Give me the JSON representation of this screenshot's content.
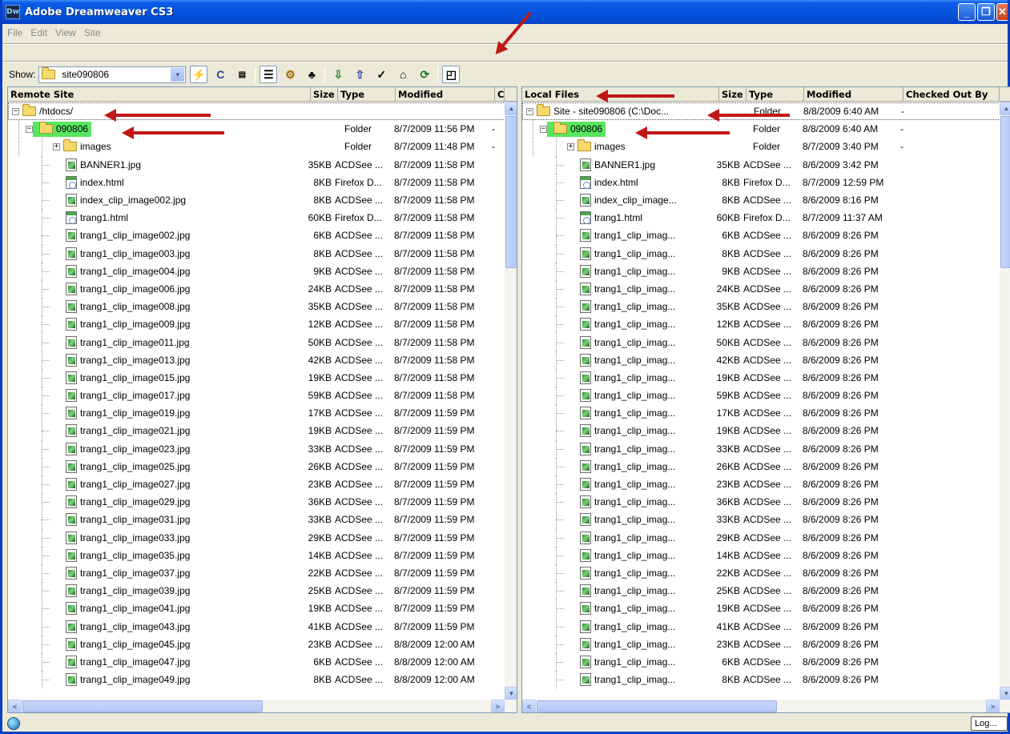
{
  "window": {
    "title": "Adobe Dreamweaver CS3",
    "logo_text": "Dw"
  },
  "menu": [
    "File",
    "Edit",
    "View",
    "Site"
  ],
  "toolbar": {
    "show_label": "Show:",
    "site_value": "site090806"
  },
  "remote": {
    "headers": [
      "Remote Site",
      "Size",
      "Type",
      "Modified",
      "C"
    ],
    "root": "/htdocs/",
    "folder": {
      "name": "090806",
      "type": "Folder",
      "modified": "8/7/2009 11:56 PM",
      "checked": "-"
    },
    "images": {
      "name": "images",
      "type": "Folder",
      "modified": "8/7/2009 11:48 PM",
      "checked": "-"
    },
    "files": [
      {
        "name": "BANNER1.jpg",
        "size": "35KB",
        "type": "ACDSee ...",
        "modified": "8/7/2009 11:58 PM",
        "icon": "image"
      },
      {
        "name": "index.html",
        "size": "8KB",
        "type": "Firefox D...",
        "modified": "8/7/2009 11:58 PM",
        "icon": "html"
      },
      {
        "name": "index_clip_image002.jpg",
        "size": "8KB",
        "type": "ACDSee ...",
        "modified": "8/7/2009 11:58 PM",
        "icon": "image"
      },
      {
        "name": "trang1.html",
        "size": "60KB",
        "type": "Firefox D...",
        "modified": "8/7/2009 11:58 PM",
        "icon": "html"
      },
      {
        "name": "trang1_clip_image002.jpg",
        "size": "6KB",
        "type": "ACDSee ...",
        "modified": "8/7/2009 11:58 PM",
        "icon": "image"
      },
      {
        "name": "trang1_clip_image003.jpg",
        "size": "8KB",
        "type": "ACDSee ...",
        "modified": "8/7/2009 11:58 PM",
        "icon": "image"
      },
      {
        "name": "trang1_clip_image004.jpg",
        "size": "9KB",
        "type": "ACDSee ...",
        "modified": "8/7/2009 11:58 PM",
        "icon": "image"
      },
      {
        "name": "trang1_clip_image006.jpg",
        "size": "24KB",
        "type": "ACDSee ...",
        "modified": "8/7/2009 11:58 PM",
        "icon": "image"
      },
      {
        "name": "trang1_clip_image008.jpg",
        "size": "35KB",
        "type": "ACDSee ...",
        "modified": "8/7/2009 11:58 PM",
        "icon": "image"
      },
      {
        "name": "trang1_clip_image009.jpg",
        "size": "12KB",
        "type": "ACDSee ...",
        "modified": "8/7/2009 11:58 PM",
        "icon": "image"
      },
      {
        "name": "trang1_clip_image011.jpg",
        "size": "50KB",
        "type": "ACDSee ...",
        "modified": "8/7/2009 11:58 PM",
        "icon": "image"
      },
      {
        "name": "trang1_clip_image013.jpg",
        "size": "42KB",
        "type": "ACDSee ...",
        "modified": "8/7/2009 11:58 PM",
        "icon": "image"
      },
      {
        "name": "trang1_clip_image015.jpg",
        "size": "19KB",
        "type": "ACDSee ...",
        "modified": "8/7/2009 11:58 PM",
        "icon": "image"
      },
      {
        "name": "trang1_clip_image017.jpg",
        "size": "59KB",
        "type": "ACDSee ...",
        "modified": "8/7/2009 11:58 PM",
        "icon": "image"
      },
      {
        "name": "trang1_clip_image019.jpg",
        "size": "17KB",
        "type": "ACDSee ...",
        "modified": "8/7/2009 11:59 PM",
        "icon": "image"
      },
      {
        "name": "trang1_clip_image021.jpg",
        "size": "19KB",
        "type": "ACDSee ...",
        "modified": "8/7/2009 11:59 PM",
        "icon": "image"
      },
      {
        "name": "trang1_clip_image023.jpg",
        "size": "33KB",
        "type": "ACDSee ...",
        "modified": "8/7/2009 11:59 PM",
        "icon": "image"
      },
      {
        "name": "trang1_clip_image025.jpg",
        "size": "26KB",
        "type": "ACDSee ...",
        "modified": "8/7/2009 11:59 PM",
        "icon": "image"
      },
      {
        "name": "trang1_clip_image027.jpg",
        "size": "23KB",
        "type": "ACDSee ...",
        "modified": "8/7/2009 11:59 PM",
        "icon": "image"
      },
      {
        "name": "trang1_clip_image029.jpg",
        "size": "36KB",
        "type": "ACDSee ...",
        "modified": "8/7/2009 11:59 PM",
        "icon": "image"
      },
      {
        "name": "trang1_clip_image031.jpg",
        "size": "33KB",
        "type": "ACDSee ...",
        "modified": "8/7/2009 11:59 PM",
        "icon": "image"
      },
      {
        "name": "trang1_clip_image033.jpg",
        "size": "29KB",
        "type": "ACDSee ...",
        "modified": "8/7/2009 11:59 PM",
        "icon": "image"
      },
      {
        "name": "trang1_clip_image035.jpg",
        "size": "14KB",
        "type": "ACDSee ...",
        "modified": "8/7/2009 11:59 PM",
        "icon": "image"
      },
      {
        "name": "trang1_clip_image037.jpg",
        "size": "22KB",
        "type": "ACDSee ...",
        "modified": "8/7/2009 11:59 PM",
        "icon": "image"
      },
      {
        "name": "trang1_clip_image039.jpg",
        "size": "25KB",
        "type": "ACDSee ...",
        "modified": "8/7/2009 11:59 PM",
        "icon": "image"
      },
      {
        "name": "trang1_clip_image041.jpg",
        "size": "19KB",
        "type": "ACDSee ...",
        "modified": "8/7/2009 11:59 PM",
        "icon": "image"
      },
      {
        "name": "trang1_clip_image043.jpg",
        "size": "41KB",
        "type": "ACDSee ...",
        "modified": "8/7/2009 11:59 PM",
        "icon": "image"
      },
      {
        "name": "trang1_clip_image045.jpg",
        "size": "23KB",
        "type": "ACDSee ...",
        "modified": "8/8/2009 12:00 AM",
        "icon": "image"
      },
      {
        "name": "trang1_clip_image047.jpg",
        "size": "6KB",
        "type": "ACDSee ...",
        "modified": "8/8/2009 12:00 AM",
        "icon": "image"
      },
      {
        "name": "trang1_clip_image049.jpg",
        "size": "8KB",
        "type": "ACDSee ...",
        "modified": "8/8/2009 12:00 AM",
        "icon": "image"
      }
    ]
  },
  "local": {
    "headers": [
      "Local Files",
      "Size",
      "Type",
      "Modified",
      "Checked Out By"
    ],
    "root": {
      "name": "Site - site090806 (C:\\Doc...",
      "type": "Folder",
      "modified": "8/8/2009 6:40 AM",
      "checked": "-"
    },
    "folder": {
      "name": "090806",
      "type": "Folder",
      "modified": "8/8/2009 6:40 AM",
      "checked": "-"
    },
    "images": {
      "name": "images",
      "type": "Folder",
      "modified": "8/7/2009 3:40 PM",
      "checked": "-"
    },
    "files": [
      {
        "name": "BANNER1.jpg",
        "size": "35KB",
        "type": "ACDSee ...",
        "modified": "8/6/2009 3:42 PM",
        "icon": "image"
      },
      {
        "name": "index.html",
        "size": "8KB",
        "type": "Firefox D...",
        "modified": "8/7/2009 12:59 PM",
        "icon": "html"
      },
      {
        "name": "index_clip_image...",
        "size": "8KB",
        "type": "ACDSee ...",
        "modified": "8/6/2009 8:16 PM",
        "icon": "image"
      },
      {
        "name": "trang1.html",
        "size": "60KB",
        "type": "Firefox D...",
        "modified": "8/7/2009 11:37 AM",
        "icon": "html"
      },
      {
        "name": "trang1_clip_imag...",
        "size": "6KB",
        "type": "ACDSee ...",
        "modified": "8/6/2009 8:26 PM",
        "icon": "image"
      },
      {
        "name": "trang1_clip_imag...",
        "size": "8KB",
        "type": "ACDSee ...",
        "modified": "8/6/2009 8:26 PM",
        "icon": "image"
      },
      {
        "name": "trang1_clip_imag...",
        "size": "9KB",
        "type": "ACDSee ...",
        "modified": "8/6/2009 8:26 PM",
        "icon": "image"
      },
      {
        "name": "trang1_clip_imag...",
        "size": "24KB",
        "type": "ACDSee ...",
        "modified": "8/6/2009 8:26 PM",
        "icon": "image"
      },
      {
        "name": "trang1_clip_imag...",
        "size": "35KB",
        "type": "ACDSee ...",
        "modified": "8/6/2009 8:26 PM",
        "icon": "image"
      },
      {
        "name": "trang1_clip_imag...",
        "size": "12KB",
        "type": "ACDSee ...",
        "modified": "8/6/2009 8:26 PM",
        "icon": "image"
      },
      {
        "name": "trang1_clip_imag...",
        "size": "50KB",
        "type": "ACDSee ...",
        "modified": "8/6/2009 8:26 PM",
        "icon": "image"
      },
      {
        "name": "trang1_clip_imag...",
        "size": "42KB",
        "type": "ACDSee ...",
        "modified": "8/6/2009 8:26 PM",
        "icon": "image"
      },
      {
        "name": "trang1_clip_imag...",
        "size": "19KB",
        "type": "ACDSee ...",
        "modified": "8/6/2009 8:26 PM",
        "icon": "image"
      },
      {
        "name": "trang1_clip_imag...",
        "size": "59KB",
        "type": "ACDSee ...",
        "modified": "8/6/2009 8:26 PM",
        "icon": "image"
      },
      {
        "name": "trang1_clip_imag...",
        "size": "17KB",
        "type": "ACDSee ...",
        "modified": "8/6/2009 8:26 PM",
        "icon": "image"
      },
      {
        "name": "trang1_clip_imag...",
        "size": "19KB",
        "type": "ACDSee ...",
        "modified": "8/6/2009 8:26 PM",
        "icon": "image"
      },
      {
        "name": "trang1_clip_imag...",
        "size": "33KB",
        "type": "ACDSee ...",
        "modified": "8/6/2009 8:26 PM",
        "icon": "image"
      },
      {
        "name": "trang1_clip_imag...",
        "size": "26KB",
        "type": "ACDSee ...",
        "modified": "8/6/2009 8:26 PM",
        "icon": "image"
      },
      {
        "name": "trang1_clip_imag...",
        "size": "23KB",
        "type": "ACDSee ...",
        "modified": "8/6/2009 8:26 PM",
        "icon": "image"
      },
      {
        "name": "trang1_clip_imag...",
        "size": "36KB",
        "type": "ACDSee ...",
        "modified": "8/6/2009 8:26 PM",
        "icon": "image"
      },
      {
        "name": "trang1_clip_imag...",
        "size": "33KB",
        "type": "ACDSee ...",
        "modified": "8/6/2009 8:26 PM",
        "icon": "image"
      },
      {
        "name": "trang1_clip_imag...",
        "size": "29KB",
        "type": "ACDSee ...",
        "modified": "8/6/2009 8:26 PM",
        "icon": "image"
      },
      {
        "name": "trang1_clip_imag...",
        "size": "14KB",
        "type": "ACDSee ...",
        "modified": "8/6/2009 8:26 PM",
        "icon": "image"
      },
      {
        "name": "trang1_clip_imag...",
        "size": "22KB",
        "type": "ACDSee ...",
        "modified": "8/6/2009 8:26 PM",
        "icon": "image"
      },
      {
        "name": "trang1_clip_imag...",
        "size": "25KB",
        "type": "ACDSee ...",
        "modified": "8/6/2009 8:26 PM",
        "icon": "image"
      },
      {
        "name": "trang1_clip_imag...",
        "size": "19KB",
        "type": "ACDSee ...",
        "modified": "8/6/2009 8:26 PM",
        "icon": "image"
      },
      {
        "name": "trang1_clip_imag...",
        "size": "41KB",
        "type": "ACDSee ...",
        "modified": "8/6/2009 8:26 PM",
        "icon": "image"
      },
      {
        "name": "trang1_clip_imag...",
        "size": "23KB",
        "type": "ACDSee ...",
        "modified": "8/6/2009 8:26 PM",
        "icon": "image"
      },
      {
        "name": "trang1_clip_imag...",
        "size": "6KB",
        "type": "ACDSee ...",
        "modified": "8/6/2009 8:26 PM",
        "icon": "image"
      },
      {
        "name": "trang1_clip_imag...",
        "size": "8KB",
        "type": "ACDSee ...",
        "modified": "8/6/2009 8:26 PM",
        "icon": "image"
      }
    ]
  },
  "status": {
    "log_label": "Log..."
  },
  "colors": {
    "title_blue": "#0655de",
    "highlight_green": "#58e660",
    "annotation_red": "#c01818"
  }
}
